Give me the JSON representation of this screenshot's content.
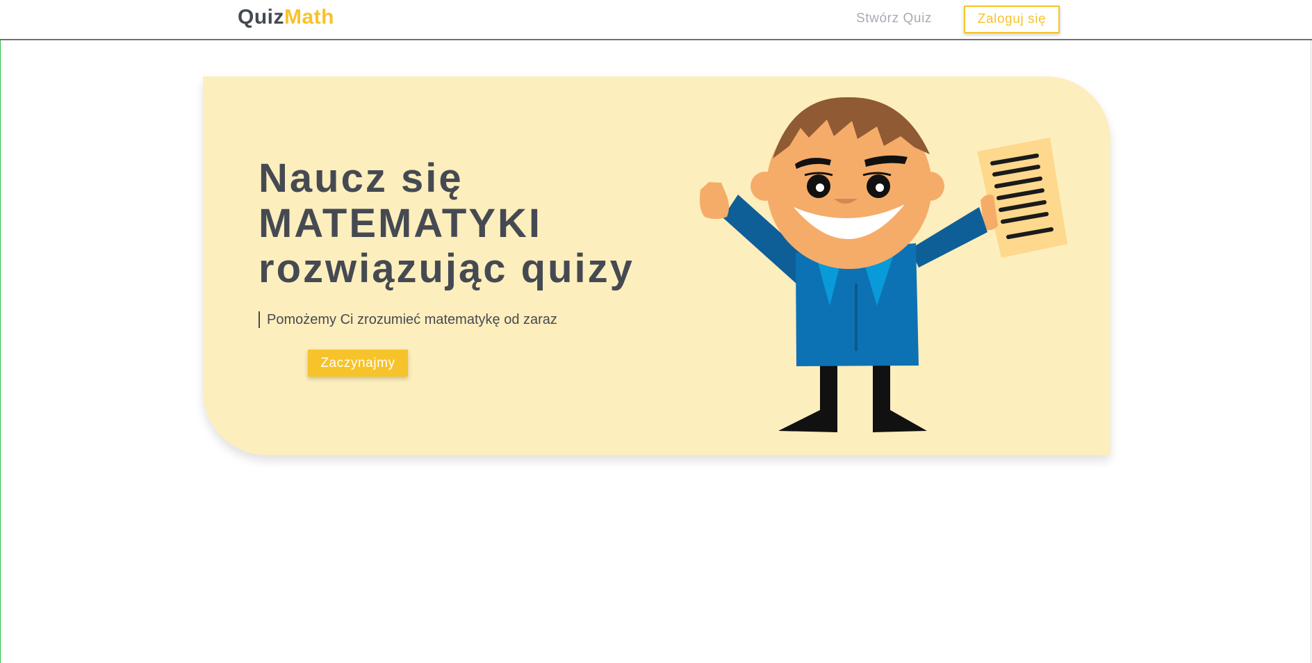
{
  "navbar": {
    "brand_part1": "Quiz",
    "brand_part2": "Math",
    "create_quiz_label": "Stwórz Quiz",
    "login_label": "Zaloguj się"
  },
  "hero": {
    "title_lines": [
      "Naucz się",
      "MATEMATYKI",
      "rozwiązując quizy"
    ],
    "subtitle": "Pomożemy Ci zrozumieć matematykę od zaraz",
    "cta_label": "Zaczynajmy"
  },
  "illustration": {
    "icon": "cartoon-boy-holding-paper-illustration"
  },
  "colors": {
    "accent": "#f7c32a",
    "text_dark": "#454a52",
    "hero_background": "#fdeebd",
    "nav_link": "#a7abb2"
  }
}
